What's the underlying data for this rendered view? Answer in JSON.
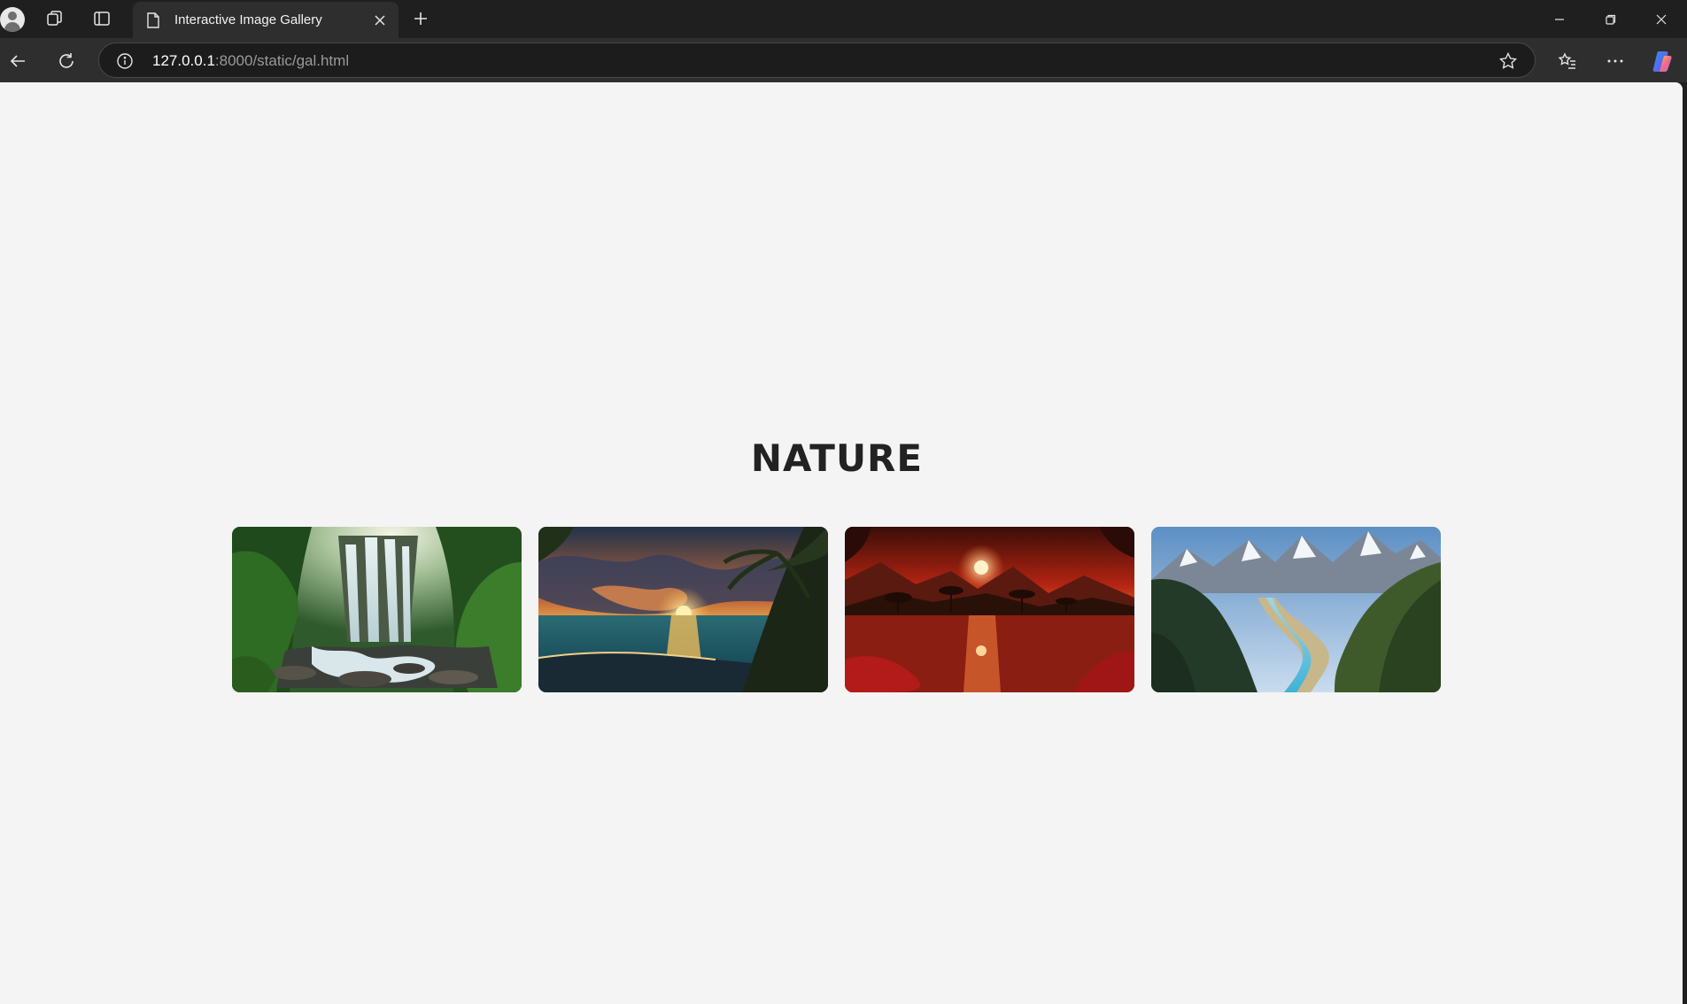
{
  "browser": {
    "tab": {
      "title": "Interactive Image Gallery"
    },
    "address": {
      "host": "127.0.0.1",
      "rest": ":8000/static/gal.html"
    }
  },
  "page": {
    "title": "NATURE",
    "images": [
      {
        "subject": "waterfall"
      },
      {
        "subject": "beach-sunset"
      },
      {
        "subject": "red-sunset-lake"
      },
      {
        "subject": "mountain-valley"
      }
    ]
  },
  "colors": {
    "titlebar": "#1f1f1f",
    "toolbar": "#2e2e2e",
    "page_background": "#f4f4f4",
    "heading": "#222222"
  }
}
